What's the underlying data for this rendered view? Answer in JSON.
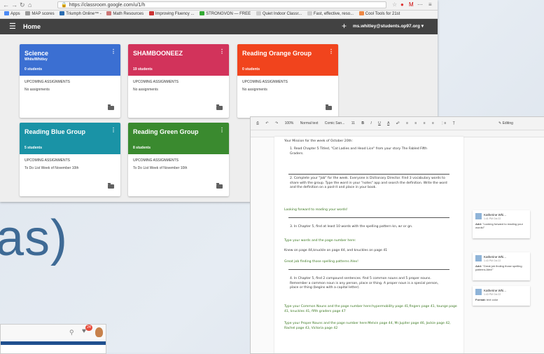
{
  "browser": {
    "url": "https://classroom.google.com/u/1/h",
    "bookmarks": [
      "Apps",
      "MAP scores",
      "Triumph Online™ -",
      "Math Resources",
      "Improving Fluency ...",
      "STRONGVON — FREE",
      "Quiet Indoor Classr...",
      "Fast, effective, reso...",
      "Cool Tools for 21st"
    ]
  },
  "classroom": {
    "title": "Home",
    "account": "ms.whitley@students.op97.org",
    "upcoming_heading": "UPCOMING ASSIGNMENTS",
    "cards": [
      {
        "name": "Science",
        "subtitle": "White/Whitley",
        "students": "0 students",
        "upcoming": "No assignments",
        "color": "#3b6fd2"
      },
      {
        "name": "SHAMBOONEEZ",
        "subtitle": "",
        "students": "19 students",
        "upcoming": "No assignments",
        "color": "#d2335b"
      },
      {
        "name": "Reading Orange Group",
        "subtitle": "",
        "students": "0 students",
        "upcoming": "No assignments",
        "color": "#f1441d"
      },
      {
        "name": "Reading Blue Group",
        "subtitle": "",
        "students": "5 students",
        "upcoming": "To Do List Week of November 10th",
        "color": "#1a93a6"
      },
      {
        "name": "Reading Green Group",
        "subtitle": "",
        "students": "8 students",
        "upcoming": "To Do List Week of November 10th",
        "color": "#3a8a2f"
      }
    ]
  },
  "bigtext": "as)",
  "mini_toolbar": {
    "badge": "24"
  },
  "doc": {
    "toolbar": {
      "zoom": "100%",
      "style": "Normal text",
      "font": "Comic San...",
      "size": "11",
      "mode": "Editing"
    },
    "mission": "Your Mission for the week of October 20th:",
    "item1": "1.  Read Chapter 5 Titled, \"Cat Ladies and Head Lice\" from your story The Fabled Fifth Graders.",
    "item2": "2.  Complete your \"Job\" for the week. Everyone is Dictionary Director. Find 3 vocabulary words to share with the group. Type the word in your \"notes\" app and search the definition. Write the word and the definition on a post-it and place in your book.",
    "reply1": "Looking forward to reading your words!",
    "item3": "3.  In Chapter 5, find at least 10 words with the spelling pattern kn, wr or gn.",
    "prompt3": "Type your words and the page number here:",
    "answer3": "Knew on page 44,knuckle on page 44, and knuckles on page 41",
    "reply2": "Great job finding those spelling patterns Alex!",
    "item4": "4.  In Chapter 5, find 2 compound sentences. find 5 common nouns and 5 proper nouns. Remember a common noun is any person, place or thing. A proper noun is a special person, place or thing (begins with a capital letter).",
    "answer4a": "Type your Common Nouns and the page number here:hypermobility page 41,fingers page 41, tounge page 41, knuckles 41, fifth graders page 47",
    "answer4b": "Type your Proper Nouns and the page number here:Melvin page 44, Mr.Jupiter page 46, Jackie page 42, Rachel page 43, Victoria page 42",
    "comments": [
      {
        "name": "Katherine Whi...",
        "time": "1:41 PM Oct 22",
        "label": "Add:",
        "text": "\"Looking forward to reading your words!\""
      },
      {
        "name": "Katherine Whi...",
        "time": "1:43 PM Oct 22",
        "label": "Add:",
        "text": "\"Great job finding those spelling patterns Alex!\""
      },
      {
        "name": "Katherine Whi...",
        "time": "1:43 PM Oct 22",
        "label": "Format:",
        "text": "text color"
      }
    ]
  }
}
